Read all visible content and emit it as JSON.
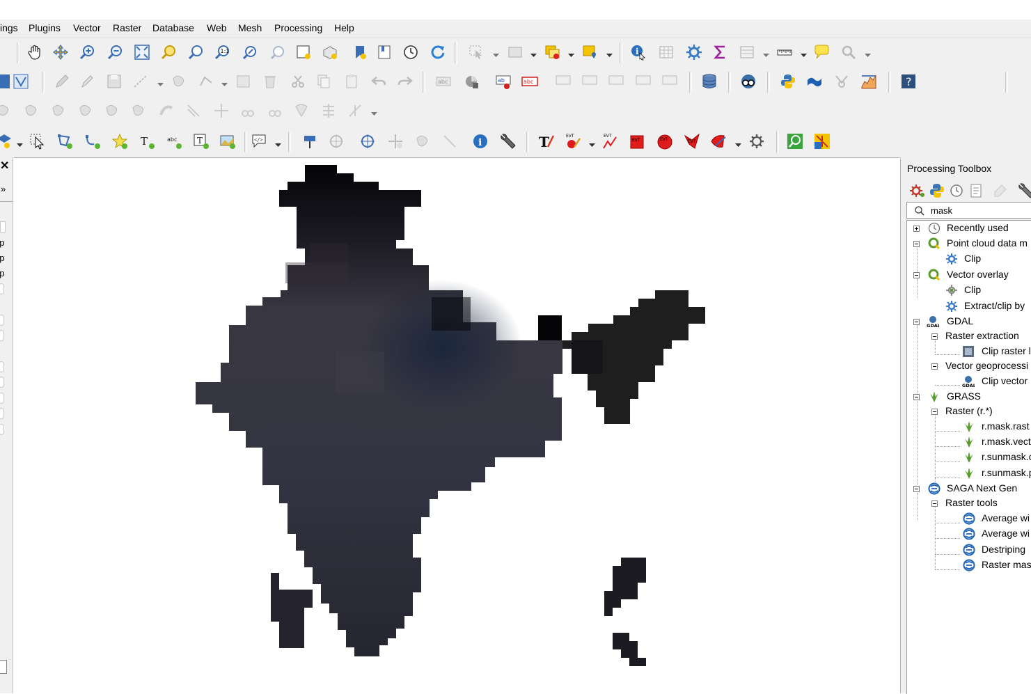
{
  "menu": {
    "settings": "ings",
    "plugins": "Plugins",
    "vector": "Vector",
    "raster": "Raster",
    "database": "Database",
    "web": "Web",
    "mesh": "Mesh",
    "processing": "Processing",
    "help": "Help"
  },
  "toolbox": {
    "title": "Processing Toolbox",
    "search_value": "mask",
    "tree": {
      "recently_used": "Recently used",
      "point_cloud": "Point cloud data m",
      "point_cloud_clip": "Clip",
      "vector_overlay": "Vector overlay",
      "vector_overlay_clip": "Clip",
      "extract_clip": "Extract/clip by",
      "gdal": "GDAL",
      "raster_extraction": "Raster extraction",
      "clip_raster": "Clip raster l",
      "vector_geoprocessing": "Vector geoprocessi",
      "clip_vector": "Clip vector",
      "grass": "GRASS",
      "raster_r": "Raster (r.*)",
      "r_mask_rast": "r.mask.rast",
      "r_mask_vect": "r.mask.vect",
      "r_sunmask_d": "r.sunmask.c",
      "r_sunmask_p": "r.sunmask.p",
      "saga": "SAGA Next Gen",
      "raster_tools": "Raster tools",
      "average_wi_1": "Average wi",
      "average_wi_2": "Average wi",
      "destriping": "Destriping",
      "raster_mask": "Raster mas"
    }
  },
  "leftpanel": {
    "close_glyph": "✕",
    "chevron_glyph": "»",
    "row_glyph": "np"
  },
  "colors": {
    "chrome": "#f0f0f0",
    "map_fill_dark": "#2a2b36",
    "map_fill_top": "#050508",
    "gear_blue": "#3a7cc4",
    "qgis_green": "#5a9b2e",
    "saga_blue": "#1f63b4"
  }
}
